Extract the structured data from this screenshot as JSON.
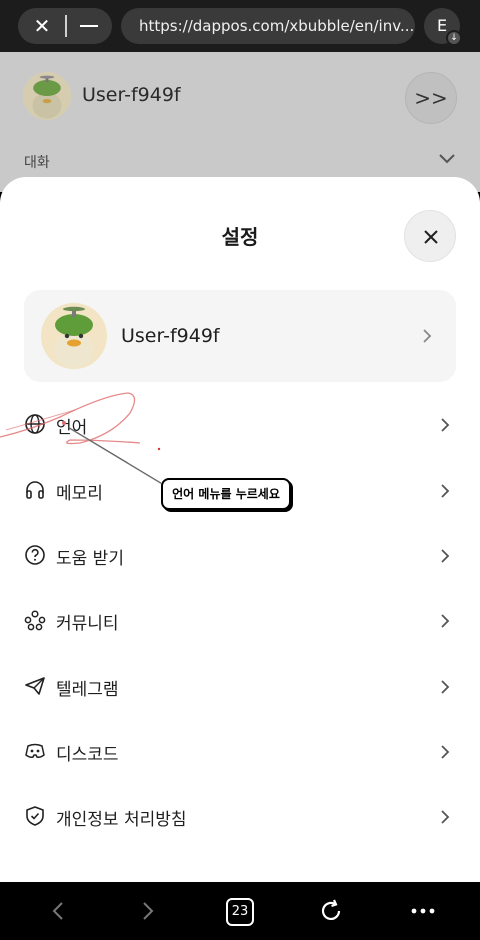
{
  "browser": {
    "url": "https://dappos.com/xbubble/en/inv...",
    "profile_initial": "E"
  },
  "background_page": {
    "username": "User-f949f",
    "section_label": "대화"
  },
  "sheet": {
    "title": "설정",
    "user": {
      "name": "User-f949f"
    },
    "menu": [
      {
        "label": "언어",
        "icon": "globe-icon"
      },
      {
        "label": "메모리",
        "icon": "headphones-icon"
      },
      {
        "label": "도움 받기",
        "icon": "help-circle-icon"
      },
      {
        "label": "커뮤니티",
        "icon": "community-icon"
      },
      {
        "label": "텔레그램",
        "icon": "telegram-icon"
      },
      {
        "label": "디스코드",
        "icon": "discord-icon"
      },
      {
        "label": "개인정보 처리방침",
        "icon": "shield-check-icon"
      }
    ]
  },
  "annotation": {
    "tooltip": "언어 메뉴를 누르세요",
    "color": "#e06b6b"
  },
  "bottom_nav": {
    "tab_count": "23"
  }
}
